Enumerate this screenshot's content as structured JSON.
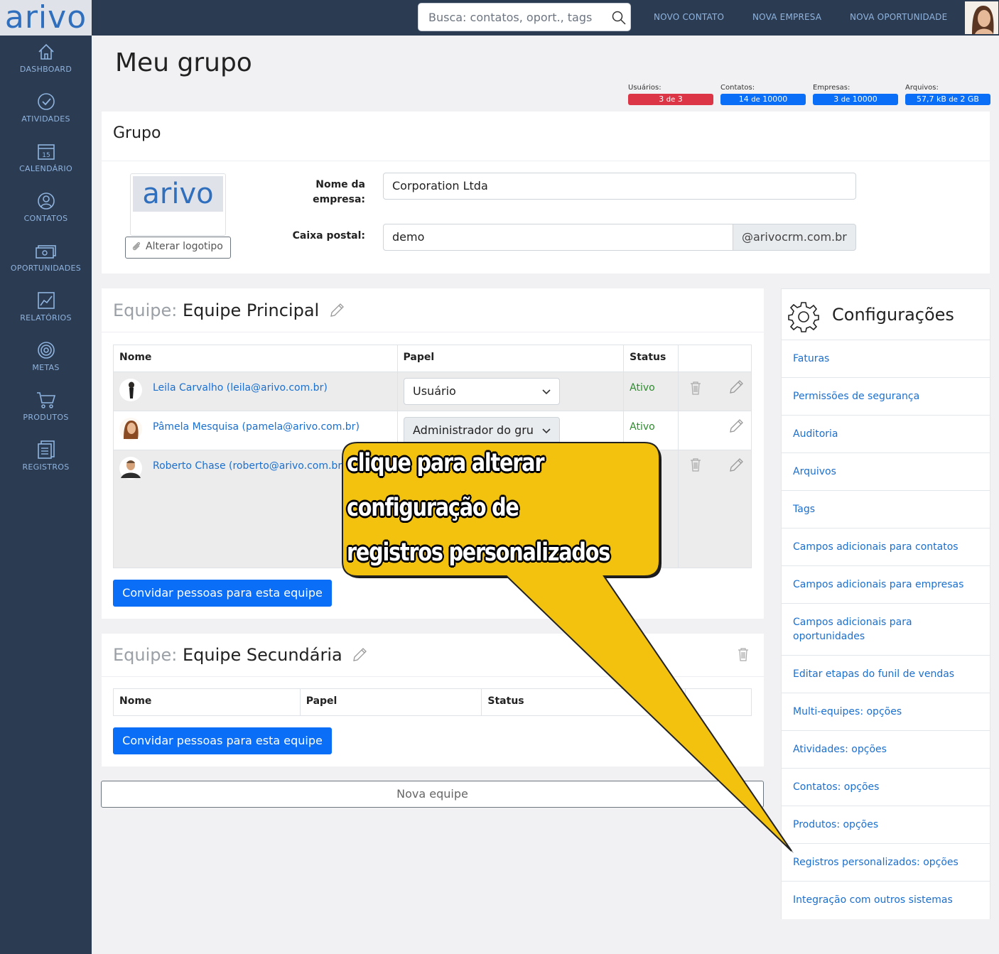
{
  "sidebar": {
    "logo_text": "arivo",
    "items": [
      {
        "label": "DASHBOARD",
        "icon": "home-icon"
      },
      {
        "label": "ATIVIDADES",
        "icon": "check-circle-icon"
      },
      {
        "label": "CALENDÁRIO",
        "icon": "calendar-icon",
        "day": "15"
      },
      {
        "label": "CONTATOS",
        "icon": "person-icon"
      },
      {
        "label": "OPORTUNIDADES",
        "icon": "money-icon"
      },
      {
        "label": "RELATÓRIOS",
        "icon": "chart-icon"
      },
      {
        "label": "METAS",
        "icon": "target-icon"
      },
      {
        "label": "PRODUTOS",
        "icon": "cart-icon"
      },
      {
        "label": "REGISTROS",
        "icon": "records-icon"
      }
    ]
  },
  "topbar": {
    "search_placeholder": "Busca: contatos, oport., tags",
    "links": [
      "NOVO CONTATO",
      "NOVA EMPRESA",
      "NOVA OPORTUNIDADE"
    ]
  },
  "page": {
    "title": "Meu grupo"
  },
  "quotas": [
    {
      "label": "Usuários:",
      "value": "3",
      "of": "de",
      "total": "3",
      "color": "#dc3545"
    },
    {
      "label": "Contatos:",
      "value": "14",
      "of": "de",
      "total": "10000",
      "color": "#0b6ef6"
    },
    {
      "label": "Empresas:",
      "value": "3",
      "of": "de",
      "total": "10000",
      "color": "#0b6ef6"
    },
    {
      "label": "Arquivos:",
      "value": "57,7 kB",
      "of": "de",
      "total": "2 GB",
      "color": "#0b6ef6"
    }
  ],
  "group": {
    "title": "Grupo",
    "logo_text": "arivo",
    "change_logo_label": "Alterar logotipo",
    "company_label_line1": "Nome da",
    "company_label_line2": "empresa:",
    "company_value": "Corporation Ltda",
    "mailbox_label": "Caixa postal:",
    "mailbox_value": "demo",
    "mailbox_domain": "@arivocrm.com.br"
  },
  "team1": {
    "prefix": "Equipe:",
    "name": "Equipe Principal",
    "columns": [
      "Nome",
      "Papel",
      "Status"
    ],
    "members": [
      {
        "name": "Leila Carvalho (leila@arivo.com.br)",
        "role": "Usuário",
        "status": "Ativo"
      },
      {
        "name": "Pâmela Mesquisa (pamela@arivo.com.br)",
        "role": "Administrador do gru",
        "status": "Ativo"
      },
      {
        "name": "Roberto Chase (roberto@arivo.com.br",
        "role": "",
        "status": ""
      }
    ],
    "invite_label": "Convidar pessoas para esta equipe"
  },
  "team2": {
    "prefix": "Equipe:",
    "name": "Equipe Secundária",
    "columns": [
      "Nome",
      "Papel",
      "Status"
    ],
    "invite_label": "Convidar pessoas para esta equipe"
  },
  "new_team_label": "Nova equipe",
  "settings": {
    "title": "Configurações",
    "items": [
      "Faturas",
      "Permissões de segurança",
      "Auditoria",
      "Arquivos",
      "Tags",
      "Campos adicionais para contatos",
      "Campos adicionais para empresas",
      "Campos adicionais para oportunidades",
      "Editar etapas do funil de vendas",
      "Multi-equipes: opções",
      "Atividades: opções",
      "Contatos: opções",
      "Produtos: opções",
      "Registros personalizados: opções",
      "Integração com outros sistemas"
    ]
  },
  "callout": {
    "lines": [
      "clique para alterar",
      "configuração de",
      "registros personalizados"
    ],
    "color": "#f2c20f"
  }
}
